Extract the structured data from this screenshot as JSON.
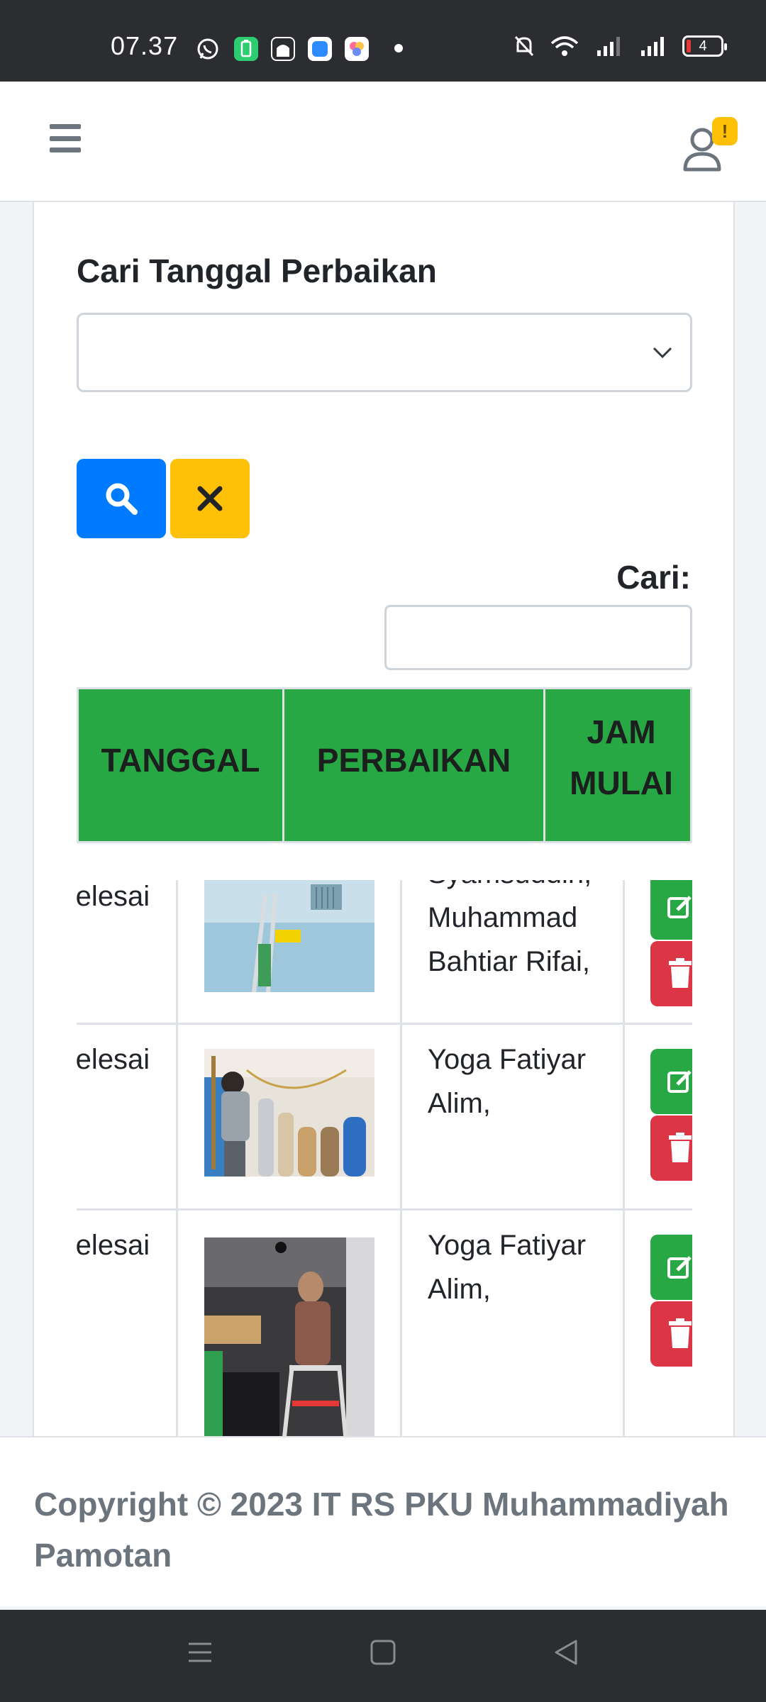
{
  "status_bar": {
    "time": "07.37",
    "battery": "4",
    "notification_icons": [
      "whatsapp-icon",
      "battery-saver-icon",
      "mosque-app-icon",
      "files-app-icon",
      "gallery-app-icon"
    ]
  },
  "nav": {
    "alert_badge": "!"
  },
  "filter": {
    "label": "Cari Tanggal Perbaikan",
    "date_value": ""
  },
  "search": {
    "label": "Cari:",
    "value": ""
  },
  "table": {
    "columns": [
      "TANGGAL",
      "PERBAIKAN",
      "JAM MULAI"
    ],
    "jam_line1": "JAM",
    "jam_line2": "MULAI",
    "rows": [
      {
        "status": "Selesai",
        "names": [
          "Syamsuddin,",
          "Muhammad",
          "Bahtiar Rifai,"
        ],
        "photo": "ceiling-vent-repair-photo"
      },
      {
        "status": "Selesai",
        "names": [
          "Yoga Fatiyar",
          "Alim,"
        ],
        "photo": "gas-cylinder-room-photo"
      },
      {
        "status": "Selesai",
        "names": [
          "Yoga Fatiyar",
          "Alim,"
        ],
        "photo": "ceiling-lamp-repair-photo"
      }
    ]
  },
  "footer": {
    "text": "Copyright © 2023 IT RS PKU Muhammadiyah Pamotan"
  },
  "colors": {
    "primary": "#007bff",
    "warning": "#ffc107",
    "success": "#28a745",
    "danger": "#dc3545",
    "muted": "#6c757d"
  }
}
